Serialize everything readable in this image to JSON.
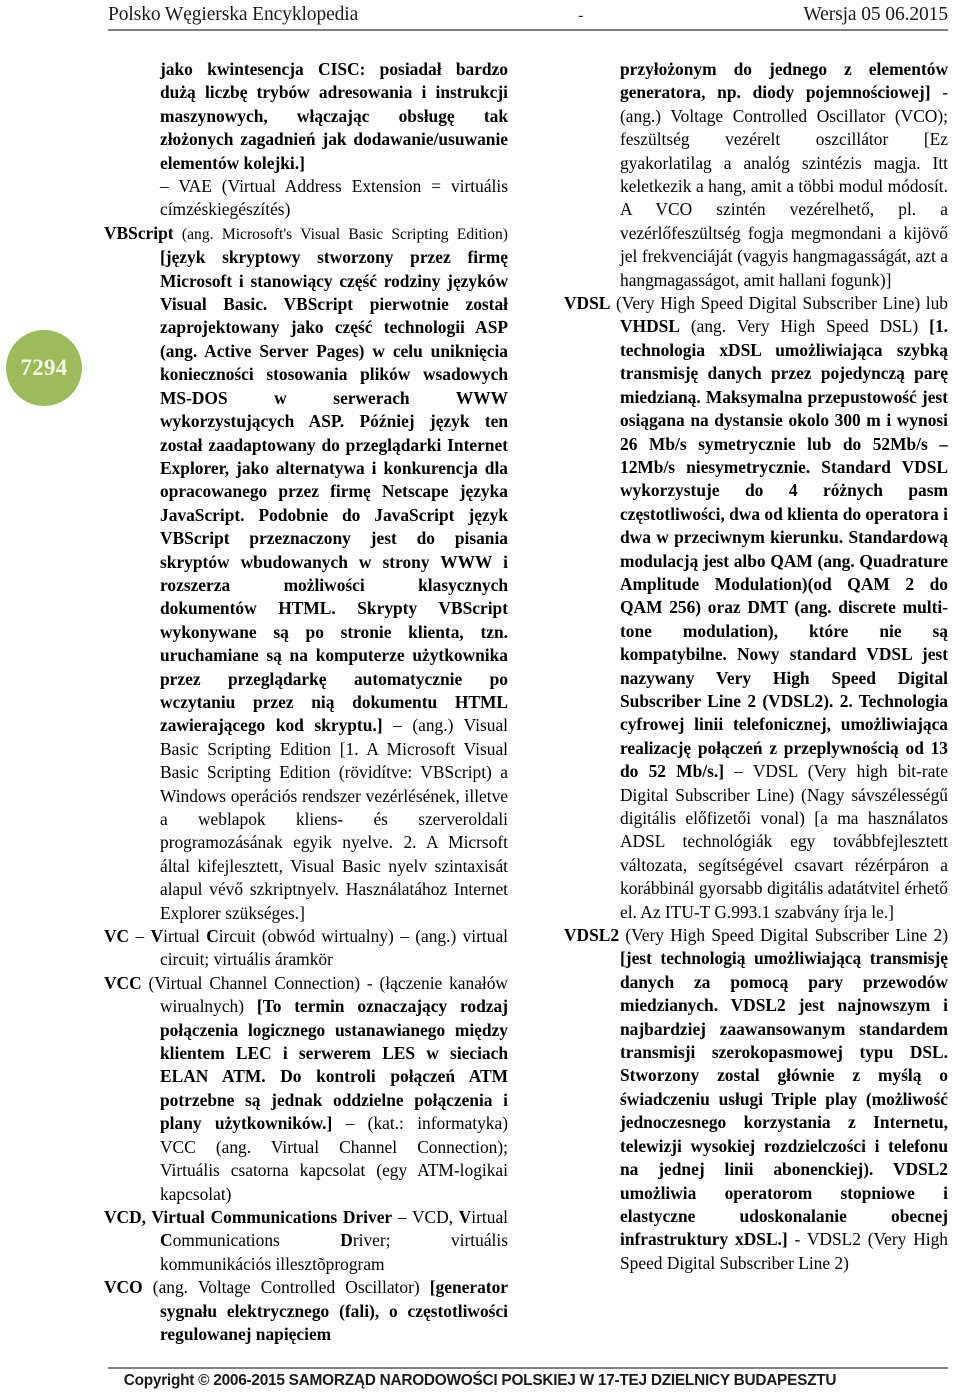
{
  "header": {
    "title": "Polsko Węgierska Encyklopedia",
    "center": "-",
    "version": "Wersja 05 06.2015"
  },
  "page_badge": {
    "number": "7294",
    "color": "#9cbb5a"
  },
  "left_column": {
    "blocks": [
      {
        "id": "vax-continuation",
        "text": "jako kwintesencja CISC: posiadał bardzo dużą liczbę trybów adresowania i instrukcji maszynowych, włączając obsługę tak złożonych zagadnień jak dodawanie/usuwanie elementów kolejki.]"
      },
      {
        "id": "vae-line",
        "text": "– VAE (Virtual Address Extension = virtuális címzéskiegészítés)"
      },
      {
        "id": "vbscript-term",
        "term": "VBScript",
        "normal_1": " (ang. Microsoft's Visual Basic Scripting Edition) ",
        "bold_1": "[język skryptowy stworzony przez firmę Microsoft i stanowiący część rodziny języków Visual Basic. VBScript pierwotnie został zaprojektowany jako część technologii ASP (ang. Active Server Pages) w celu uniknięcia konieczności stosowania plików wsadowych MS-DOS w serwerach WWW wykorzystujących ASP. Później język ten został zaadaptowany do przeglądarki Internet Explorer, jako alternatywa i konkurencja dla opracowanego przez firmę Netscape języka JavaScript. Podobnie do JavaScript język VBScript przeznaczony jest do pisania skryptów wbudowanych w strony WWW i rozszerza możliwości klasycznych dokumentów HTML. Skrypty VBScript wykonywane są po stronie klienta, tzn. uruchamiane są na komputerze użytkownika przez przeglądarkę automatycznie po wczytaniu przez nią dokumentu HTML zawierającego kod skryptu.]",
        "normal_2": " – (ang.) Visual Basic Scripting Edition [1. A Microsoft Visual Basic Scripting Edition (rövidítve: VBScript) a Windows operációs rendszer vezérlésének, illetve a weblapok kliens- és szerveroldali programozásának egyik nyelve. 2. A Micrsoft által kifejlesztett, Visual Basic nyelv szintaxisát alapul vévő szkriptnyelv. Használatához Internet Explorer szükséges.]"
      },
      {
        "id": "vc-term",
        "term": "VC",
        "normal_1": " – ",
        "bold_1": "V",
        "normal_2": "irtual ",
        "bold_2": "C",
        "normal_3": "ircuit  (obwód wirtualny) – (ang.) virtual circuit; virtuális áramkör"
      },
      {
        "id": "vcc-term",
        "term": "VCC",
        "normal_1": " (Virtual Channel Connection) - (łączenie kanałów wirualnych) ",
        "bold_1": "[To termin oznaczający rodzaj połączenia logicznego ustanawianego między klientem LEC i serwerem LES w sieciach ELAN ATM. Do kontroli połączeń ATM potrzebne są jednak oddzielne połączenia i plany użytkowników.]",
        "normal_2": " – (kat.: informatyka) VCC (ang. Virtual Channel Connection); Virtuális csatorna kapcsolat (egy ATM-logikai kapcsolat)"
      },
      {
        "id": "vcd-term",
        "term": "VCD,",
        "bold_1": " Virtual Communications Driver",
        "normal_1": " – VCD, ",
        "bold_2": "V",
        "normal_2": "irtual ",
        "bold_3": "C",
        "normal_3": "ommunications ",
        "bold_4": "D",
        "normal_4": "river; virtuális kommunikációs illesztõprogram"
      },
      {
        "id": "vco-term",
        "term": "VCO",
        "normal_1": " (ang. Voltage Controlled Oscillator) ",
        "bold_1": "[generator sygnału elektrycznego (fali), o częstotliwości regulowanej napięciem"
      }
    ]
  },
  "right_column": {
    "blocks": [
      {
        "id": "vco-continuation",
        "bold_1": "przyłożonym do jednego z elementów generatora, np. diody pojemnościowej]",
        "normal_1": " - (ang.) Voltage Controlled Oscillator (VCO); feszültség vezérelt oszcillátor [Ez gyakorlatilag a analóg szintézis magja. Itt keletkezik a hang, amit a többi modul módosít. A VCO szintén vezérelhető, pl. a vezérlőfeszültség fogja megmondani a kijövő jel frekvenciáját (vagyis hangmagasságát, azt a hangmagasságot, amit hallani fogunk)]"
      },
      {
        "id": "vdsl-term",
        "term": "VDSL",
        "normal_1": " (Very High Speed Digital Subscriber Line) lub ",
        "bold_1": "VHDSL",
        "normal_2": " (ang. Very High Speed DSL) ",
        "bold_2": "[1. technologia xDSL umożliwiająca szybką transmisję danych przez pojedynczą parę miedzianą. Maksymalna przepustowość jest osiągana na dystansie okolo 300 m i wynosi 26 Mb/s symetrycznie lub do 52Mb/s – 12Mb/s niesymetrycznie. Standard VDSL wykorzystuje do 4 różnych pasm częstotliwości, dwa od klienta do operatora i dwa w przeciwnym kierunku. Standardową modulacją jest albo QAM (ang. Quadrature Amplitude Modulation)(od QAM 2 do QAM 256) oraz DMT (ang. discrete multi-tone modulation), które nie są kompatybilne. Nowy standard VDSL jest nazywany Very High Speed Digital Subscriber Line 2 (VDSL2). 2. Technologia cyfrowej linii telefonicznej, umożliwiająca realizację połączeń z przeplywnością od 13 do 52 Mb/s.]",
        "normal_3": " – VDSL (Very high bit-rate Digital Subscriber Line) (Nagy sávszélességű digitális előfizetői vonal) [a ma használatos ADSL technológiák egy továbbfejlesztett változata, segítségével csavart rézérpáron a korábbinál gyorsabb digitális adatátvitel érhető el. Az ITU-T G.993.1 szabvány írja le.]"
      },
      {
        "id": "vdsl2-term",
        "term": "VDSL2",
        "normal_1": " (Very High Speed Digital Subscriber Line 2) ",
        "bold_1": "[jest technologią umożliwiającą transmisję danych za pomocą pary przewodów miedzianych. VDSL2 jest najnowszym i najbardziej zaawansowanym standardem transmisji szerokopasmowej typu DSL. Stworzony zostal głównie z myślą o świadczeniu usługi Triple play (możliwość jednoczesnego korzystania z Internetu, telewizji wysokiej rozdzielczości i telefonu na jednej linii abonenckiej). VDSL2 umożliwia operatorom stopniowe i elastyczne udoskonalanie obecnej infrastruktury xDSL.]",
        "normal_2": " - VDSL2 (Very High Speed Digital Subscriber Line 2)"
      }
    ]
  },
  "footer": {
    "copyright": "Copyright © 2006-2015 SAMORZĄD NARODOWOŚCI POLSKIEJ W 17-TEJ DZIELNICY BUDAPESZTU"
  }
}
